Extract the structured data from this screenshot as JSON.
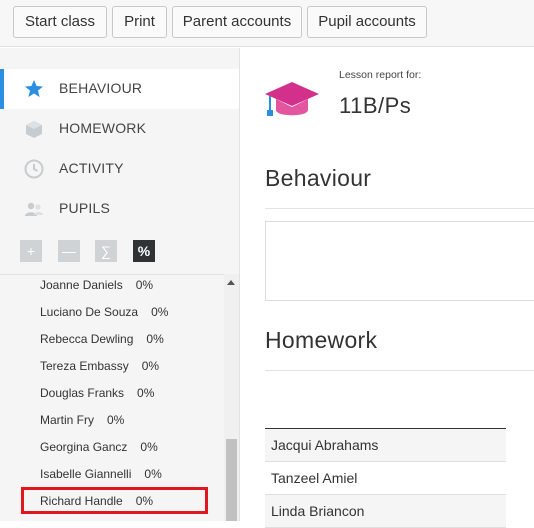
{
  "toolbar": {
    "buttons": [
      {
        "label": "Start class"
      },
      {
        "label": "Print"
      },
      {
        "label": "Parent accounts"
      },
      {
        "label": "Pupil accounts"
      }
    ]
  },
  "sidebar": {
    "nav": [
      {
        "label": "BEHAVIOUR",
        "icon": "star-icon",
        "active": true
      },
      {
        "label": "HOMEWORK",
        "icon": "box-icon",
        "active": false
      },
      {
        "label": "ACTIVITY",
        "icon": "clock-icon",
        "active": false
      },
      {
        "label": "PUPILS",
        "icon": "people-icon",
        "active": false
      }
    ],
    "controls": [
      {
        "label": "+",
        "icon": "plus-icon"
      },
      {
        "label": "—",
        "icon": "minus-icon"
      },
      {
        "label": "∑",
        "icon": "sum-icon"
      },
      {
        "label": "%",
        "icon": "percent-icon",
        "active": true
      }
    ],
    "pupils": [
      {
        "name": "Joanne Daniels",
        "pct": "0%"
      },
      {
        "name": "Luciano De Souza",
        "pct": "0%"
      },
      {
        "name": "Rebecca Dewling",
        "pct": "0%"
      },
      {
        "name": "Tereza Embassy",
        "pct": "0%"
      },
      {
        "name": "Douglas Franks",
        "pct": "0%"
      },
      {
        "name": "Martin Fry",
        "pct": "0%"
      },
      {
        "name": "Georgina Gancz",
        "pct": "0%"
      },
      {
        "name": "Isabelle Giannelli",
        "pct": "0%"
      },
      {
        "name": "Richard Handle",
        "pct": "0%",
        "highlighted": true
      }
    ]
  },
  "main": {
    "report_label": "Lesson report for:",
    "class_name": "11B/Ps",
    "sections": {
      "behaviour": "Behaviour",
      "homework": "Homework"
    },
    "homework_pupils": [
      "Jacqui Abrahams",
      "Tanzeel Amiel",
      "Linda Briancon"
    ]
  },
  "colors": {
    "accent": "#2a8fe0",
    "highlight": "#e0171e",
    "logo": "#d2308a"
  }
}
